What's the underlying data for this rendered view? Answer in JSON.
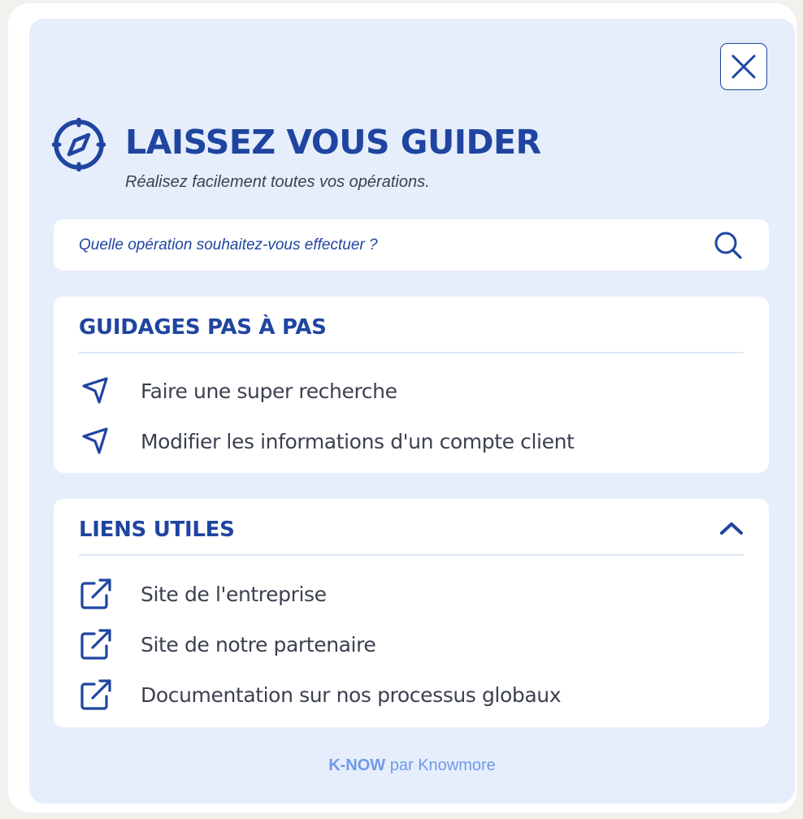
{
  "header": {
    "title": "LAISSEZ VOUS GUIDER",
    "subtitle": "Réalisez facilement toutes vos opérations.",
    "icon": "compass-icon",
    "close_icon": "close-icon"
  },
  "search": {
    "placeholder": "Quelle opération souhaitez-vous effectuer ?",
    "value": "",
    "icon": "search-icon"
  },
  "guides": {
    "title": "GUIDAGES PAS À PAS",
    "items": [
      {
        "label": "Faire une super recherche",
        "icon": "navigation-arrow-icon"
      },
      {
        "label": "Modifier les informations d'un compte client",
        "icon": "navigation-arrow-icon"
      }
    ]
  },
  "links": {
    "title": "LIENS UTILES",
    "expanded": true,
    "toggle_icon": "chevron-up-icon",
    "items": [
      {
        "label": "Site de l'entreprise",
        "icon": "external-link-icon"
      },
      {
        "label": "Site de notre partenaire",
        "icon": "external-link-icon"
      },
      {
        "label": "Documentation sur nos processus globaux",
        "icon": "external-link-icon"
      }
    ]
  },
  "footer": {
    "brand": "K-NOW",
    "by": "par Knowmore"
  },
  "colors": {
    "primary": "#1f45a0",
    "panel_bg": "#e6eefc",
    "card_bg": "#ffffff",
    "text": "#3c4150",
    "footer": "#6f9ae8"
  }
}
